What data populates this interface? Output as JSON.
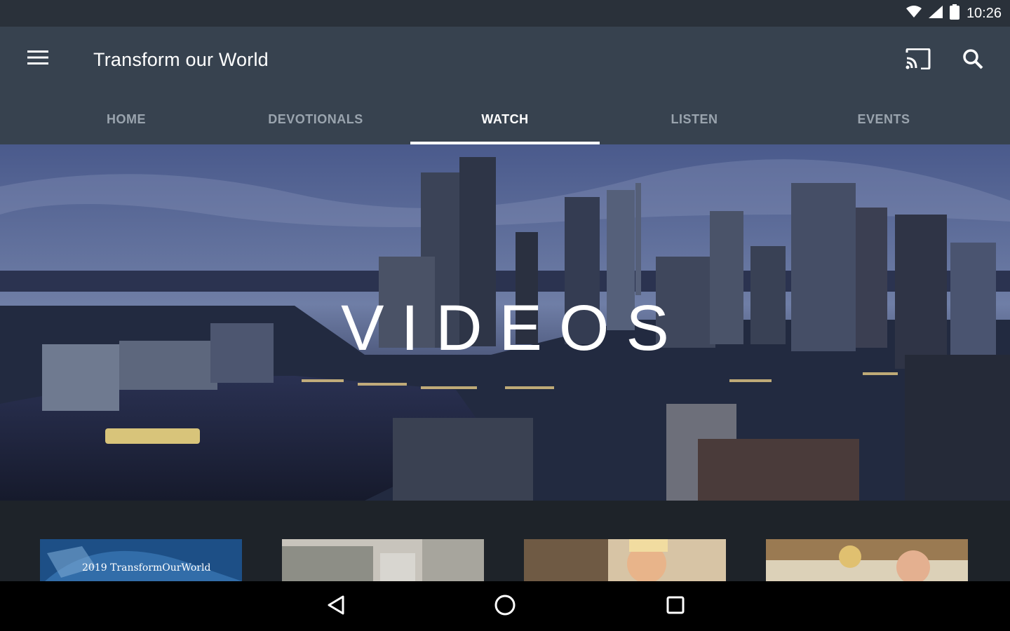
{
  "status_bar": {
    "time": "10:26"
  },
  "app_bar": {
    "title": "Transform our World",
    "icons": {
      "menu": "menu-icon",
      "cast": "cast-icon",
      "search": "search-icon"
    }
  },
  "tabs": [
    {
      "label": "HOME",
      "active": false
    },
    {
      "label": "DEVOTIONALS",
      "active": false
    },
    {
      "label": "WATCH",
      "active": true
    },
    {
      "label": "LISTEN",
      "active": false
    },
    {
      "label": "EVENTS",
      "active": false
    }
  ],
  "hero": {
    "title": "VIDEOS"
  },
  "videos": [
    {
      "label": "2019 TransformOurWorld"
    },
    {
      "label": ""
    },
    {
      "label": ""
    },
    {
      "label": ""
    }
  ],
  "colors": {
    "app_bar": "#37424f",
    "status_bar": "#2a313a",
    "background": "#1e2329",
    "tab_inactive": "#9aa4ae",
    "tab_active": "#ffffff"
  }
}
